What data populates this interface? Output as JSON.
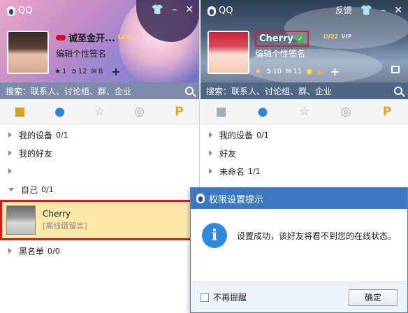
{
  "left_panel": {
    "app_title": "QQ",
    "nickname": "诚至金开...",
    "level_badge": "LV30",
    "signature": "编辑个性签名",
    "counts": {
      "star": "1",
      "qzone": "12",
      "mail": "8"
    },
    "search_placeholder": "搜索：联系人、讨论组、群、企业",
    "groups": [
      {
        "name": "我的设备",
        "count": "0/1"
      },
      {
        "name": "我的好友",
        "count": ""
      },
      {
        "name": "",
        "count": ""
      },
      {
        "name": "自己",
        "count": "0/1"
      }
    ],
    "contact": {
      "name": "Cherry",
      "status": "[离线请留言]"
    },
    "blacklist": {
      "name": "黑名单",
      "count": "0/0"
    }
  },
  "right_panel": {
    "app_title": "QQ",
    "feedback": "反馈",
    "nickname": "Cherry",
    "level_badge": "LV22",
    "vip": "VIP",
    "signature": "编辑个性签名",
    "counts": {
      "qzone": "10",
      "mail": "11"
    },
    "search_placeholder": "搜索：联系人、讨论组、群、企业",
    "groups": [
      {
        "name": "我的设备",
        "count": "0/1"
      },
      {
        "name": "好友",
        "count": ""
      },
      {
        "name": "未命名",
        "count": "1/1"
      }
    ]
  },
  "dialog": {
    "title": "权限设置提示",
    "message": "设置成功，该好友将看不到您的在线状态。",
    "checkbox_label": "不再提醒",
    "ok_label": "确定"
  },
  "colors": {
    "title_blue": "#3c78bf",
    "highlight_red": "#e1141b",
    "selected_row": "#fde8a9",
    "tab_active": "#2c86d8"
  },
  "icons": [
    "qq-penguin-icon",
    "shirt-icon",
    "minimize-icon",
    "close-icon",
    "star-icon",
    "qzone-icon",
    "mail-icon",
    "plus-icon",
    "search-icon",
    "chat-tab-icon",
    "contact-tab-icon",
    "favorite-tab-icon",
    "group-tab-icon",
    "p-tab-icon",
    "info-icon"
  ]
}
